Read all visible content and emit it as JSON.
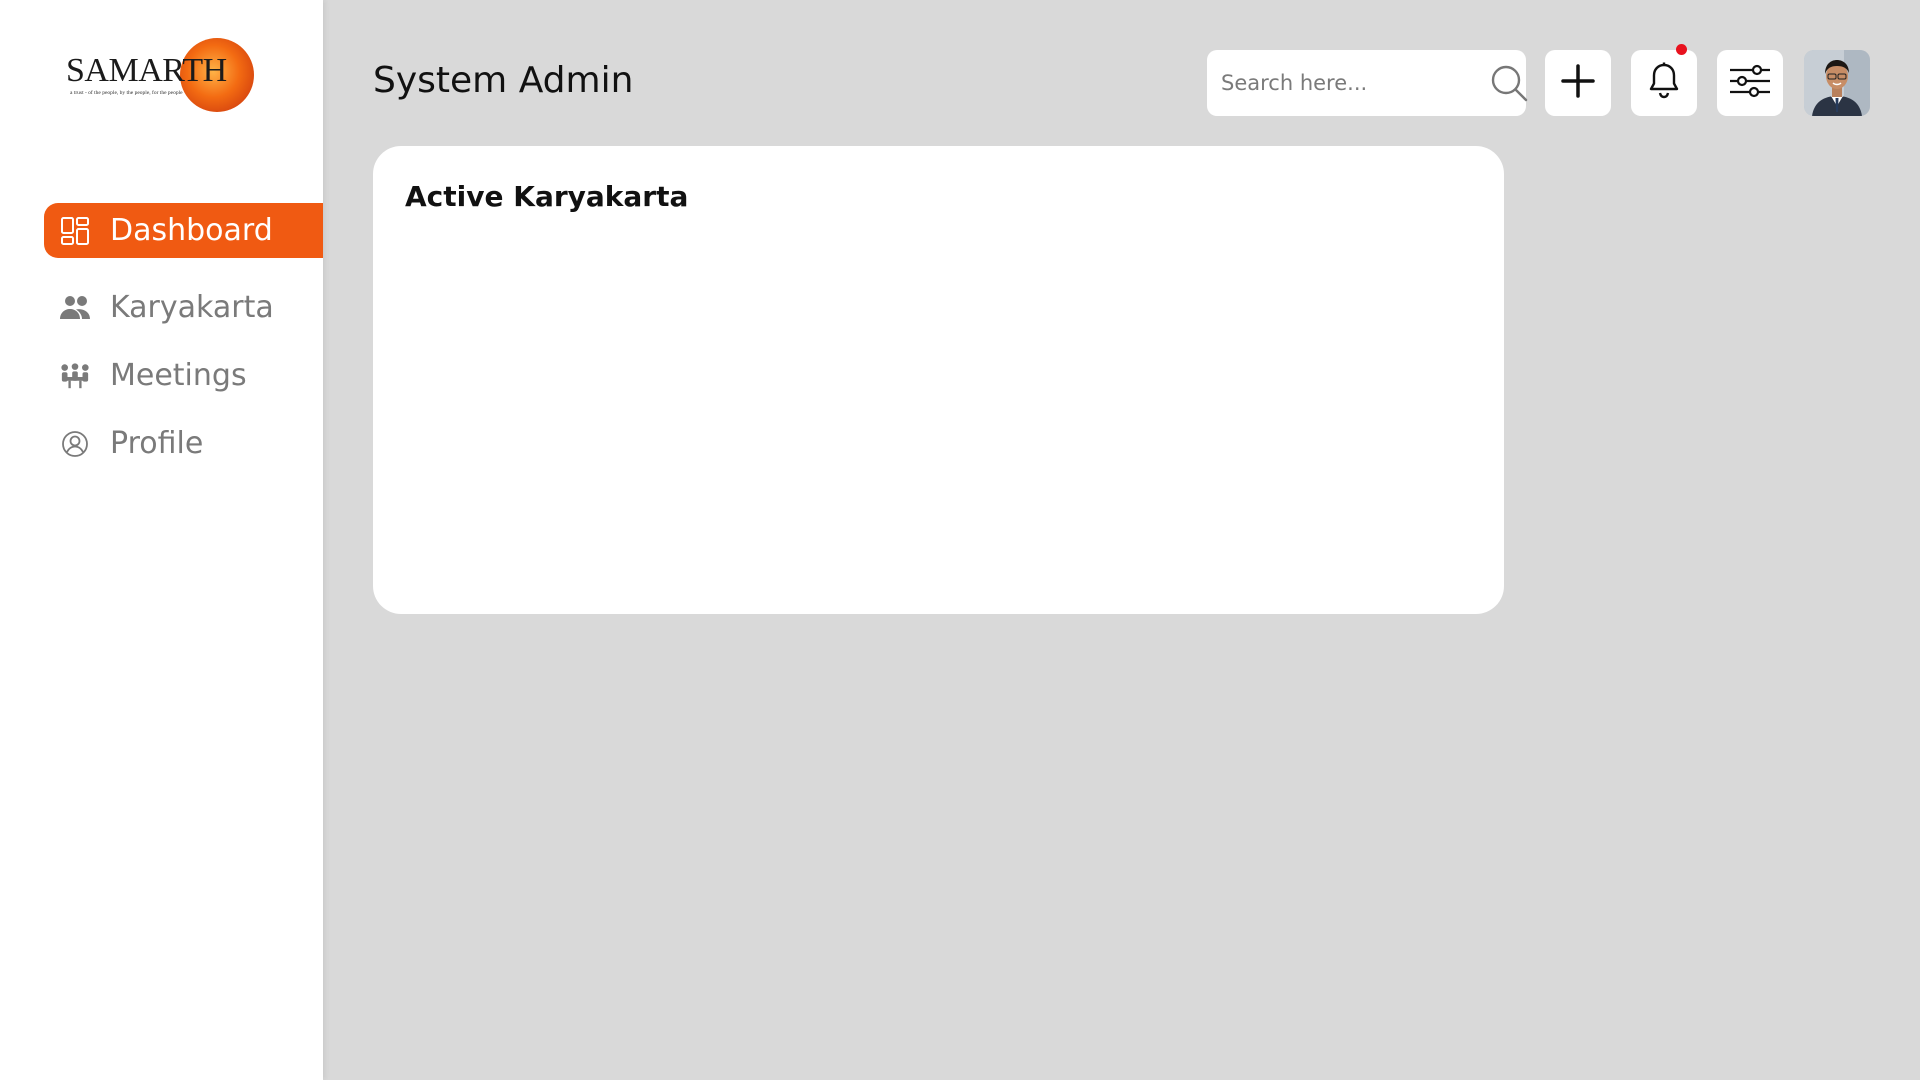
{
  "brand": {
    "name": "SAMARTH",
    "tagline": "a trust - of the people, by the people, for the people",
    "sun_color": "#f36b12"
  },
  "sidebar": {
    "items": [
      {
        "label": "Dashboard",
        "icon": "dashboard-icon",
        "active": true
      },
      {
        "label": "Karyakarta",
        "icon": "users-icon",
        "active": false
      },
      {
        "label": "Meetings",
        "icon": "meeting-icon",
        "active": false
      },
      {
        "label": "Profile",
        "icon": "profile-icon",
        "active": false
      }
    ],
    "accent": "#f05a12"
  },
  "header": {
    "title": "System Admin",
    "search": {
      "placeholder": "Search here...",
      "value": ""
    },
    "buttons": {
      "add": "plus-icon",
      "notifications": "bell-icon",
      "settings": "sliders-icon",
      "avatar": "user-avatar"
    },
    "notification_dot_color": "#e8121e"
  },
  "main": {
    "card": {
      "title": "Active Karyakarta"
    }
  }
}
